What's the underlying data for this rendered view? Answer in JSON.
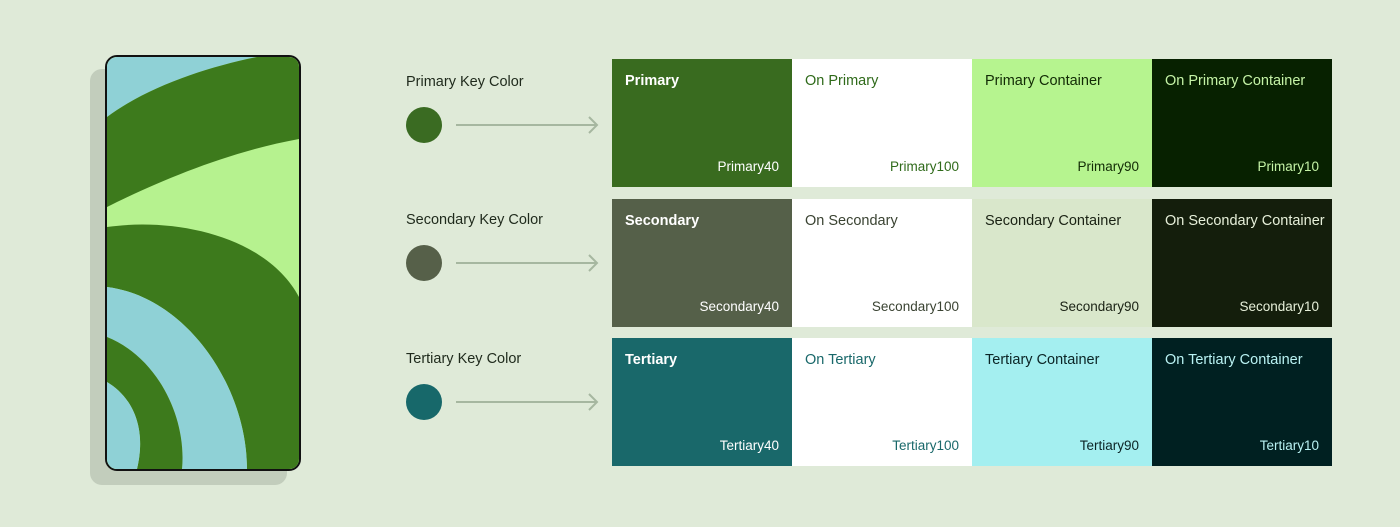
{
  "rows": [
    {
      "key_label": "Primary Key Color",
      "key_color": "#3a6b22",
      "swatches": [
        {
          "name": "Primary",
          "tone": "Primary40",
          "bg": "#396b1f",
          "fg": "#ffffff"
        },
        {
          "name": "On Primary",
          "tone": "Primary100",
          "bg": "#ffffff",
          "fg": "#2f6a1a"
        },
        {
          "name": "Primary Container",
          "tone": "Primary90",
          "bg": "#b6f48f",
          "fg": "#122b05"
        },
        {
          "name": "On Primary Container",
          "tone": "Primary10",
          "bg": "#072100",
          "fg": "#c5f3a6"
        }
      ]
    },
    {
      "key_label": "Secondary Key Color",
      "key_color": "#566049",
      "swatches": [
        {
          "name": "Secondary",
          "tone": "Secondary40",
          "bg": "#556049",
          "fg": "#ffffff"
        },
        {
          "name": "On Secondary",
          "tone": "Secondary100",
          "bg": "#ffffff",
          "fg": "#3a4332"
        },
        {
          "name": "Secondary Container",
          "tone": "Secondary90",
          "bg": "#d9e7cb",
          "fg": "#1a2214"
        },
        {
          "name": "On Secondary Container",
          "tone": "Secondary10",
          "bg": "#141e0c",
          "fg": "#e6efd9"
        }
      ]
    },
    {
      "key_label": "Tertiary Key Color",
      "key_color": "#17686a",
      "swatches": [
        {
          "name": "Tertiary",
          "tone": "Tertiary40",
          "bg": "#19686a",
          "fg": "#ffffff"
        },
        {
          "name": "On Tertiary",
          "tone": "Tertiary100",
          "bg": "#ffffff",
          "fg": "#19686a"
        },
        {
          "name": "Tertiary Container",
          "tone": "Tertiary90",
          "bg": "#a4eff0",
          "fg": "#0b2425"
        },
        {
          "name": "On Tertiary Container",
          "tone": "Tertiary10",
          "bg": "#002021",
          "fg": "#b9f2f3"
        }
      ]
    }
  ],
  "colors": {
    "background": "#dfead8",
    "phone_light_green": "#b6f28f",
    "phone_dark_green": "#3d7a1c",
    "phone_cyan": "#8fd1d6",
    "arrow": "#a6b7a0"
  }
}
